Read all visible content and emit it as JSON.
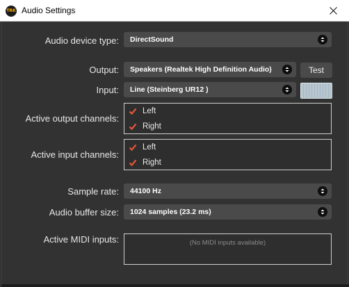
{
  "window": {
    "title": "Audio Settings",
    "app_icon_text": "TRK"
  },
  "device_type": {
    "label": "Audio device type:",
    "value": "DirectSound"
  },
  "output": {
    "label": "Output:",
    "value": "Speakers (Realtek High Definition Audio)",
    "test_label": "Test"
  },
  "input": {
    "label": "Input:",
    "value": "Line (Steinberg UR12 )"
  },
  "active_output_channels": {
    "label": "Active output channels:",
    "channels": [
      {
        "label": "Left",
        "checked": true
      },
      {
        "label": "Right",
        "checked": true
      }
    ]
  },
  "active_input_channels": {
    "label": "Active input channels:",
    "channels": [
      {
        "label": "Left",
        "checked": true
      },
      {
        "label": "Right",
        "checked": true
      }
    ]
  },
  "sample_rate": {
    "label": "Sample rate:",
    "value": "44100 Hz"
  },
  "buffer_size": {
    "label": "Audio buffer size:",
    "value": "1024 samples (23.2 ms)"
  },
  "midi_inputs": {
    "label": "Active MIDI inputs:",
    "empty_text": "(No MIDI inputs available)"
  },
  "colors": {
    "checkmark": "#e8563a",
    "combo_bg": "#4a4a4a",
    "panel_bg": "#323232"
  }
}
